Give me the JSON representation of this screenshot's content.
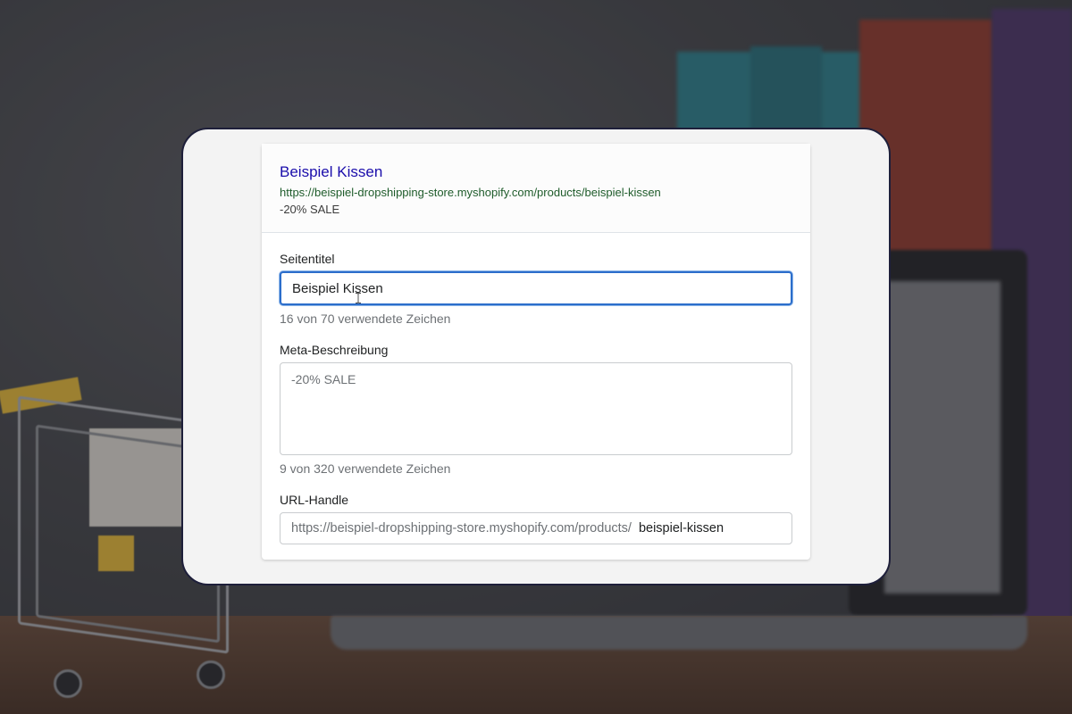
{
  "preview": {
    "title": "Beispiel Kissen",
    "url": "https://beispiel-dropshipping-store.myshopify.com/products/beispiel-kissen",
    "description": "-20% SALE"
  },
  "seo_form": {
    "page_title": {
      "label": "Seitentitel",
      "value": "Beispiel Kissen",
      "help": "16 von 70 verwendete Zeichen"
    },
    "meta_description": {
      "label": "Meta-Beschreibung",
      "value": "-20% SALE",
      "help": "9 von 320 verwendete Zeichen"
    },
    "url_handle": {
      "label": "URL-Handle",
      "prefix": "https://beispiel-dropshipping-store.myshopify.com/products/",
      "value": "beispiel-kissen"
    }
  },
  "icons": {
    "text_cursor": "text-cursor-icon"
  },
  "colors": {
    "preview_title": "#1a0dab",
    "preview_url": "#1f5c2b",
    "focus_border": "#2c6ecb",
    "frame_border": "#1e1f3a"
  }
}
